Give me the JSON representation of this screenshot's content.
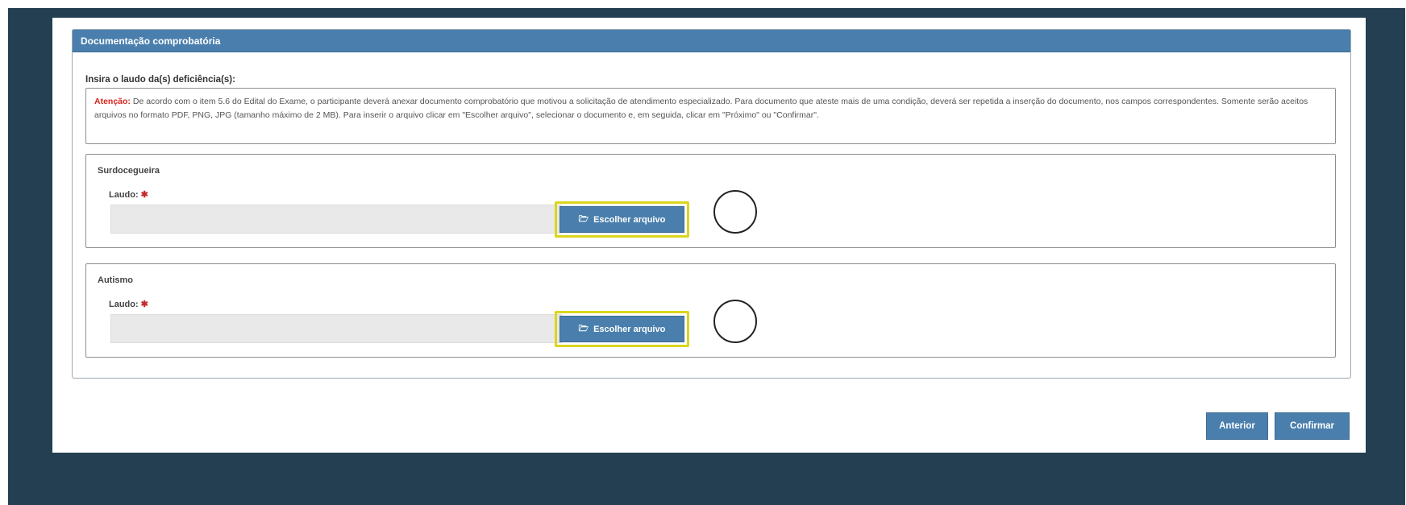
{
  "panel": {
    "title": "Documentação comprobatória",
    "instruction": "Insira o laudo da(s) deficiência(s):",
    "notice": {
      "attention_label": "Atenção:",
      "text": " De acordo com o item 5.6 do Edital do Exame, o participante deverá anexar documento comprobatório que motivou a solicitação de atendimento especializado. Para documento que ateste mais de uma condição, deverá ser repetida a inserção do documento, nos campos correspondentes. Somente serão aceitos arquivos no formato PDF, PNG, JPG (tamanho máximo de 2 MB). Para inserir o arquivo clicar em \"Escolher arquivo\", selecionar o documento e, em seguida, clicar em \"Próximo\" ou \"Confirmar\"."
    },
    "sections": [
      {
        "title": "Surdocegueira",
        "field_label": "Laudo:",
        "required_mark": "✱",
        "file_value": "",
        "button_label": "Escolher arquivo",
        "button_icon": "folder-open-icon"
      },
      {
        "title": "Autismo",
        "field_label": "Laudo:",
        "required_mark": "✱",
        "file_value": "",
        "button_label": "Escolher arquivo",
        "button_icon": "folder-open-icon"
      }
    ]
  },
  "footer": {
    "previous_label": "Anterior",
    "confirm_label": "Confirmar"
  },
  "colors": {
    "header_blue": "#4a7fad",
    "background_dark": "#253f52",
    "highlight_yellow": "#dbd51d",
    "attention_red": "#d9241c"
  }
}
